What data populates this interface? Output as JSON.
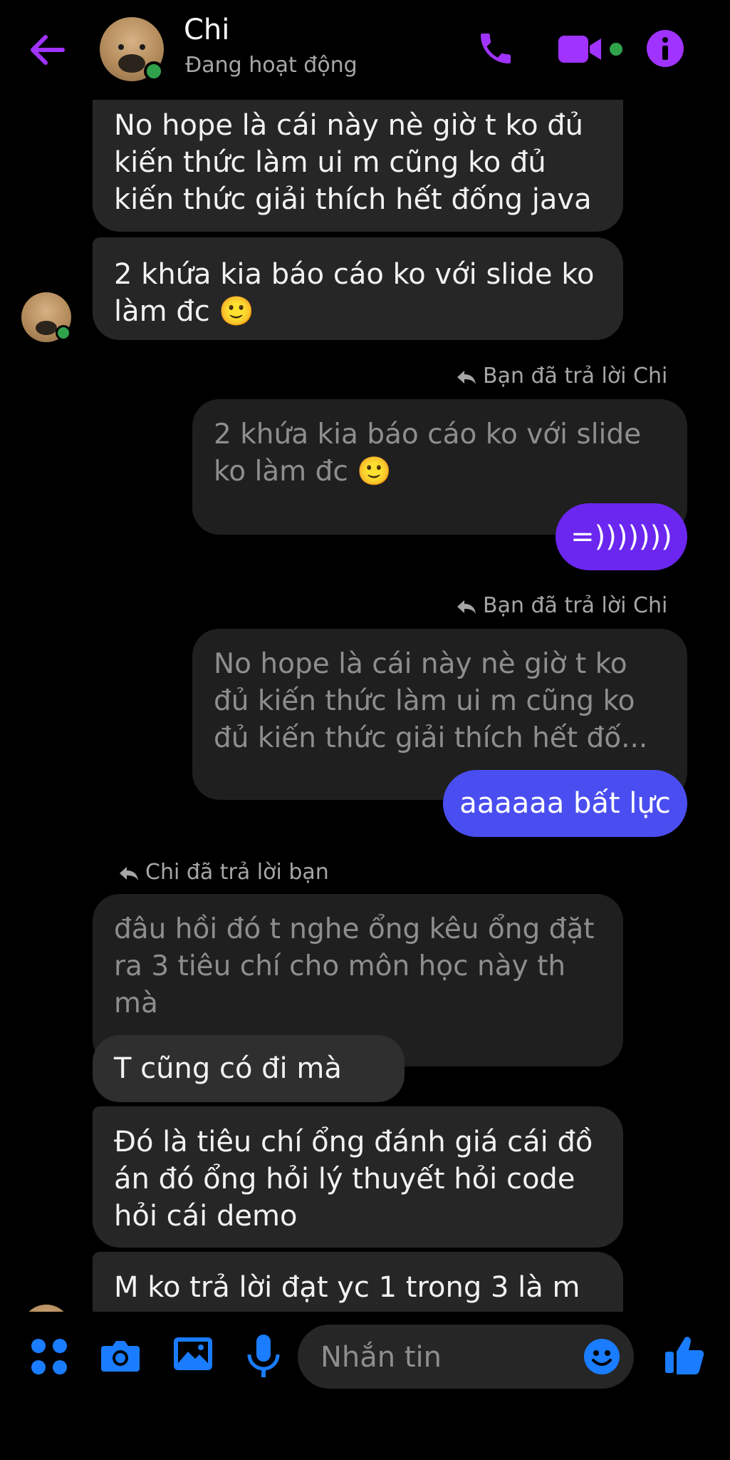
{
  "header": {
    "name": "Chi",
    "status": "Đang hoạt động"
  },
  "messages": {
    "m1": "No hope là cái này nè giờ t ko đủ kiến thức làm ui m cũng ko đủ kiến thức giải thích hết đống java",
    "m2": "2 khứa kia báo cáo ko với slide ko làm đc 🙂",
    "reply1_label": "Bạn đã trả lời Chi",
    "reply1_quote": "2 khứa kia báo cáo ko với slide ko làm đc 🙂",
    "reply1_text": "=)))))))",
    "reply2_label": "Bạn đã trả lời Chi",
    "reply2_quote": "No hope là cái này nè giờ t ko đủ kiến thức làm ui m cũng ko đủ kiến thức giải thích hết đố...",
    "reply2_text": "aaaaaa bất lực",
    "reply3_label": "Chi đã trả lời bạn",
    "reply3_quote": "đâu hồi đó t nghe ổng kêu ổng đặt ra 3 tiêu chí cho môn học này th mà",
    "reply3_text": "T cũng có đi mà :)))",
    "m3": "Đó là tiêu chí ổng đánh giá cái đồ án đó ổng hỏi lý thuyết hỏi code hỏi cái demo",
    "m4": "M ko trả lời đạt yc 1 trong 3 là m"
  },
  "composer": {
    "placeholder": "Nhắn tin"
  },
  "colors": {
    "accent": "#a033ff",
    "outgoing_top": "#6b26f0",
    "outgoing_bottom": "#4a4ef0",
    "toolbar_blue": "#1a7cff",
    "online": "#31a24c",
    "incoming_bubble": "#262626"
  },
  "icons": [
    "back-arrow-icon",
    "phone-icon",
    "video-icon",
    "info-icon",
    "reply-icon",
    "apps-icon",
    "camera-icon",
    "image-icon",
    "mic-icon",
    "emoji-icon",
    "thumbs-up-icon"
  ]
}
